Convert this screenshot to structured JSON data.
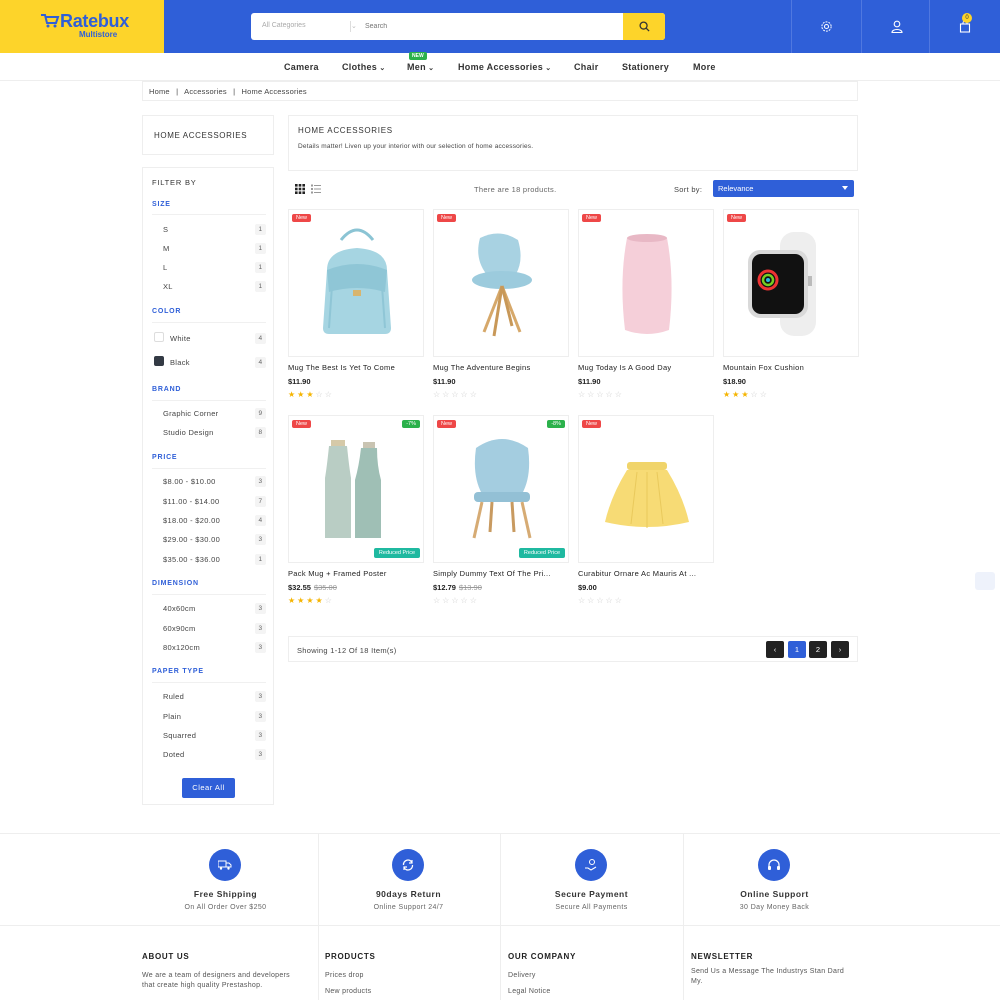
{
  "brand": {
    "name": "Ratebux",
    "tagline": "Multistore"
  },
  "search": {
    "category": "All Categories",
    "placeholder": "Search"
  },
  "header": {
    "cart_count": "0"
  },
  "nav": {
    "items": [
      "Camera",
      "Clothes",
      "Men",
      "Home Accessories",
      "Chair",
      "Stationery",
      "More"
    ],
    "new_badge": "NEW"
  },
  "breadcrumb": [
    "Home",
    "|",
    "Accessories",
    "|",
    "Home Accessories"
  ],
  "sidebar": {
    "category_title": "HOME ACCESSORIES",
    "filter_title": "FILTER BY",
    "groups": {
      "size": {
        "title": "SIZE",
        "items": [
          {
            "label": "S",
            "count": "1"
          },
          {
            "label": "M",
            "count": "1"
          },
          {
            "label": "L",
            "count": "1"
          },
          {
            "label": "XL",
            "count": "1"
          }
        ]
      },
      "color": {
        "title": "COLOR",
        "items": [
          {
            "label": "White",
            "count": "4",
            "swatch": "#ffffff"
          },
          {
            "label": "Black",
            "count": "4",
            "swatch": "#333a44"
          }
        ]
      },
      "brand": {
        "title": "BRAND",
        "items": [
          {
            "label": "Graphic Corner",
            "count": "9"
          },
          {
            "label": "Studio Design",
            "count": "8"
          }
        ]
      },
      "price": {
        "title": "PRICE",
        "items": [
          {
            "label": "$8.00 - $10.00",
            "count": "3"
          },
          {
            "label": "$11.00 - $14.00",
            "count": "7"
          },
          {
            "label": "$18.00 - $20.00",
            "count": "4"
          },
          {
            "label": "$29.00 - $30.00",
            "count": "3"
          },
          {
            "label": "$35.00 - $36.00",
            "count": "1"
          }
        ]
      },
      "dimension": {
        "title": "DIMENSION",
        "items": [
          {
            "label": "40x60cm",
            "count": "3"
          },
          {
            "label": "60x90cm",
            "count": "3"
          },
          {
            "label": "80x120cm",
            "count": "3"
          }
        ]
      },
      "paper": {
        "title": "PAPER TYPE",
        "items": [
          {
            "label": "Ruled",
            "count": "3"
          },
          {
            "label": "Plain",
            "count": "3"
          },
          {
            "label": "Squarred",
            "count": "3"
          },
          {
            "label": "Doted",
            "count": "3"
          }
        ]
      }
    },
    "clear_label": "Clear All"
  },
  "category": {
    "title": "HOME ACCESSORIES",
    "description": "Details matter! Liven up your interior with our selection of home accessories."
  },
  "toolbar": {
    "count_text": "There are 18 products.",
    "sort_label": "Sort by:",
    "sort_value": "Relevance"
  },
  "products": [
    {
      "name": "Mug The Best Is Yet To Come",
      "price": "$11.90",
      "old_price": "",
      "badge": "New",
      "discount": "",
      "reduced": "",
      "rating": 3,
      "image": "backpack"
    },
    {
      "name": "Mug The Adventure Begins",
      "price": "$11.90",
      "old_price": "",
      "badge": "New",
      "discount": "",
      "reduced": "",
      "rating": 0,
      "image": "chair"
    },
    {
      "name": "Mug Today Is A Good Day",
      "price": "$11.90",
      "old_price": "",
      "badge": "New",
      "discount": "",
      "reduced": "",
      "rating": 0,
      "image": "vase"
    },
    {
      "name": "Mountain Fox Cushion",
      "price": "$18.90",
      "old_price": "",
      "badge": "New",
      "discount": "",
      "reduced": "",
      "rating": 3,
      "image": "watch"
    },
    {
      "name": "Pack Mug + Framed Poster",
      "price": "$32.55",
      "old_price": "$35.00",
      "badge": "New",
      "discount": "-7%",
      "reduced": "Reduced Price",
      "rating": 4,
      "image": "bottles"
    },
    {
      "name": "Simply Dummy Text Of The Pri...",
      "price": "$12.79",
      "old_price": "$13.90",
      "badge": "New",
      "discount": "-8%",
      "reduced": "Reduced Price",
      "rating": 0,
      "image": "chair2"
    },
    {
      "name": "Curabitur Ornare Ac Mauris At ...",
      "price": "$9.00",
      "old_price": "",
      "badge": "New",
      "discount": "",
      "reduced": "",
      "rating": 0,
      "image": "skirt"
    }
  ],
  "pagination": {
    "showing": "Showing 1-12 Of 18 Item(s)",
    "pages": [
      "1",
      "2"
    ],
    "current": "1"
  },
  "services": [
    {
      "title": "Free Shipping",
      "subtitle": "On All Order Over $250",
      "icon": "truck-icon"
    },
    {
      "title": "90days Return",
      "subtitle": "Online Support 24/7",
      "icon": "refresh-icon"
    },
    {
      "title": "Secure Payment",
      "subtitle": "Secure All Payments",
      "icon": "payment-icon"
    },
    {
      "title": "Online Support",
      "subtitle": "30 Day Money Back",
      "icon": "headset-icon"
    }
  ],
  "footer": {
    "about": {
      "title": "ABOUT US",
      "text": "We are a team of designers and developers that create high quality Prestashop."
    },
    "products": {
      "title": "PRODUCTS",
      "links": [
        "Prices drop",
        "New products"
      ]
    },
    "company": {
      "title": "OUR COMPANY",
      "links": [
        "Delivery",
        "Legal Notice"
      ]
    },
    "newsletter": {
      "title": "NEWSLETTER",
      "text": "Send Us a Message The Industrys Stan Dard My."
    }
  },
  "colors": {
    "primary": "#2f5fd8",
    "accent": "#fdd42a",
    "new_badge": "#ee4747",
    "discount": "#2bb14b",
    "reduced": "#1fb9a0",
    "star": "#f5b400"
  }
}
